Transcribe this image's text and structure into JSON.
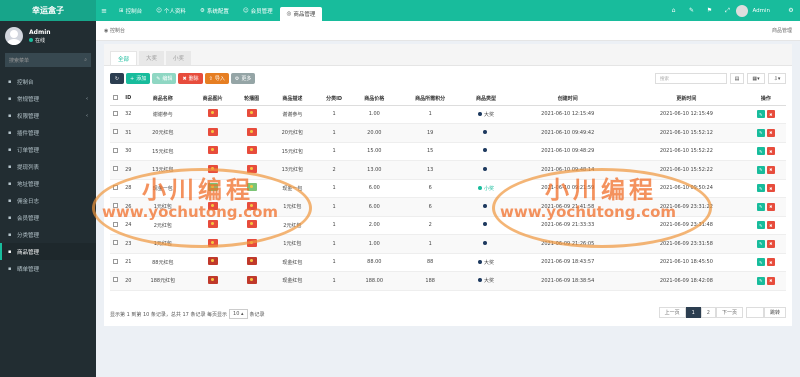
{
  "app": {
    "logo": "幸运盒子"
  },
  "topnav": {
    "items": [
      {
        "label": "控制台",
        "active": false
      },
      {
        "label": "个人资料",
        "active": false
      },
      {
        "label": "系统配置",
        "active": false
      },
      {
        "label": "会员管理",
        "active": false
      },
      {
        "label": "商品管理",
        "active": true
      }
    ],
    "user": "Admin"
  },
  "sidebar": {
    "user_name": "Admin",
    "status": "在线",
    "search_placeholder": "搜索菜单",
    "items": [
      {
        "label": "控制台",
        "arrow": false,
        "active": false
      },
      {
        "label": "常规管理",
        "arrow": true,
        "active": false
      },
      {
        "label": "权限管理",
        "arrow": true,
        "active": false
      },
      {
        "label": "插件管理",
        "arrow": false,
        "active": false
      },
      {
        "label": "订单管理",
        "arrow": false,
        "active": false
      },
      {
        "label": "提现列表",
        "arrow": false,
        "active": false
      },
      {
        "label": "地址管理",
        "arrow": false,
        "active": false
      },
      {
        "label": "佣金日志",
        "arrow": false,
        "active": false
      },
      {
        "label": "会员管理",
        "arrow": false,
        "active": false
      },
      {
        "label": "分类管理",
        "arrow": false,
        "active": false
      },
      {
        "label": "商品管理",
        "arrow": false,
        "active": true
      },
      {
        "label": "晒单管理",
        "arrow": false,
        "active": false
      }
    ]
  },
  "breadcrumb": {
    "left": "控制台",
    "right": "商品管理"
  },
  "tabs": [
    "全部",
    "大奖",
    "小奖"
  ],
  "toolbar": {
    "add": "添加",
    "edit": "编辑",
    "delete": "删除",
    "import": "导入",
    "more": "更多",
    "search_placeholder": "搜索"
  },
  "table": {
    "headers": [
      "ID",
      "商品名称",
      "商品图片",
      "轮播图",
      "商品描述",
      "分类ID",
      "商品价格",
      "商品所需积分",
      "商品类型",
      "创建时间",
      "更新时间",
      "操作"
    ],
    "rows": [
      {
        "id": "32",
        "name": "谢谢参与",
        "desc": "谢谢参与",
        "cat": "1",
        "price": "1.00",
        "points": "1",
        "type": "大奖",
        "type_dot": "dark",
        "created": "2021-06-10 12:15:49",
        "updated": "2021-06-10 12:15:49",
        "img": "r"
      },
      {
        "id": "31",
        "name": "20元红包",
        "desc": "20元红包",
        "cat": "1",
        "price": "20.00",
        "points": "19",
        "type": "",
        "type_dot": "dark",
        "created": "2021-06-10 09:49:42",
        "updated": "2021-06-10 15:52:12",
        "img": "r"
      },
      {
        "id": "30",
        "name": "15元红包",
        "desc": "15元红包",
        "cat": "1",
        "price": "15.00",
        "points": "15",
        "type": "",
        "type_dot": "dark",
        "created": "2021-06-10 09:48:29",
        "updated": "2021-06-10 15:52:22",
        "img": "r"
      },
      {
        "id": "29",
        "name": "13元红包",
        "desc": "13元红包",
        "cat": "2",
        "price": "13.00",
        "points": "13",
        "type": "",
        "type_dot": "dark",
        "created": "2021-06-10 09:48:14",
        "updated": "2021-06-10 15:52:22",
        "img": "r"
      },
      {
        "id": "28",
        "name": "现金一包",
        "desc": "现金一包",
        "cat": "1",
        "price": "6.00",
        "points": "6",
        "type": "小奖",
        "type_dot": "green",
        "created": "2021-06-10 09:21:59",
        "updated": "2021-06-10 09:50:24",
        "img": "g"
      },
      {
        "id": "26",
        "name": "1元红包",
        "desc": "1元红包",
        "cat": "1",
        "price": "6.00",
        "points": "6",
        "type": "",
        "type_dot": "dark",
        "created": "2021-06-09 21:41:58",
        "updated": "2021-06-09 23:31:22",
        "img": "r"
      },
      {
        "id": "24",
        "name": "2元红包",
        "desc": "2元红包",
        "cat": "1",
        "price": "2.00",
        "points": "2",
        "type": "",
        "type_dot": "dark",
        "created": "2021-06-09 21:33:33",
        "updated": "2021-06-09 23:31:48",
        "img": "r"
      },
      {
        "id": "23",
        "name": "1元红包",
        "desc": "1元红包",
        "cat": "1",
        "price": "1.00",
        "points": "1",
        "type": "",
        "type_dot": "dark",
        "created": "2021-06-09 21:26:05",
        "updated": "2021-06-09 23:31:58",
        "img": "r"
      },
      {
        "id": "21",
        "name": "88元红包",
        "desc": "现金红包",
        "cat": "1",
        "price": "88.00",
        "points": "88",
        "type": "大奖",
        "type_dot": "dark",
        "created": "2021-06-09 18:43:57",
        "updated": "2021-06-10 18:45:50",
        "img": "b"
      },
      {
        "id": "20",
        "name": "188元红包",
        "desc": "现金红包",
        "cat": "1",
        "price": "188.00",
        "points": "188",
        "type": "大奖",
        "type_dot": "dark",
        "created": "2021-06-09 18:38:54",
        "updated": "2021-06-09 18:42:08",
        "img": "b"
      }
    ]
  },
  "pagination": {
    "info": "显示第 1 到第 10 条记录，总共 17 条记录 每页显示",
    "per_page": "10",
    "info_suffix": "条记录",
    "prev": "上一页",
    "pages": [
      "1",
      "2"
    ],
    "current": "1",
    "next": "下一页",
    "jump": "跳转"
  },
  "watermark": {
    "cn": "小川编程",
    "url": "www.yochutong.com"
  },
  "colors": {
    "brand": "#18bc9c",
    "sidebar": "#222d32",
    "danger": "#e74c3c"
  }
}
